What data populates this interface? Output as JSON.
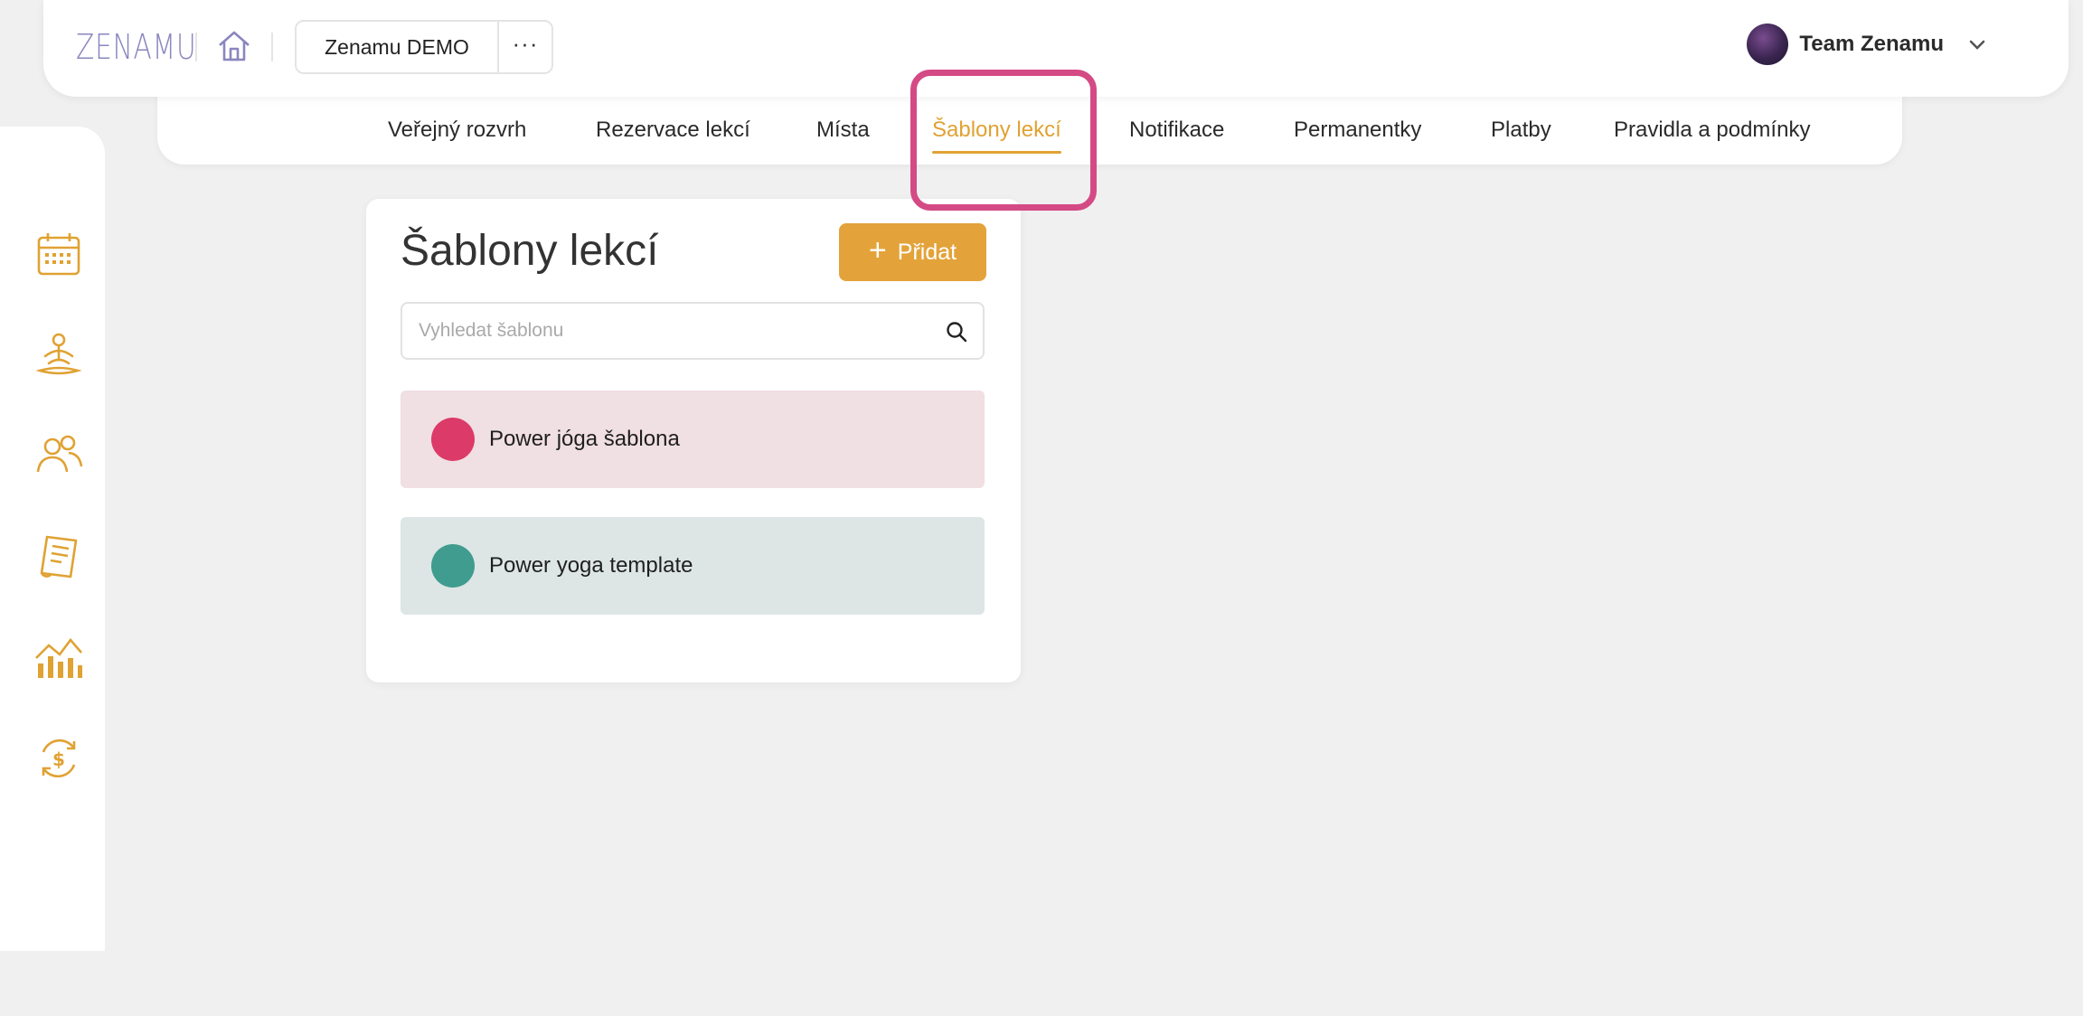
{
  "header": {
    "logo": "ZENAMU",
    "workspace_name": "Zenamu DEMO",
    "more_label": "···",
    "user_name": "Team Zenamu"
  },
  "tabs": [
    {
      "label": "Veřejný rozvrh",
      "active": false
    },
    {
      "label": "Rezervace lekcí",
      "active": false
    },
    {
      "label": "Místa",
      "active": false
    },
    {
      "label": "Šablony lekcí",
      "active": true
    },
    {
      "label": "Notifikace",
      "active": false
    },
    {
      "label": "Permanentky",
      "active": false
    },
    {
      "label": "Platby",
      "active": false
    },
    {
      "label": "Pravidla a podmínky",
      "active": false
    }
  ],
  "sidebar": {
    "items": [
      {
        "icon": "calendar-icon"
      },
      {
        "icon": "yoga-icon"
      },
      {
        "icon": "users-icon"
      },
      {
        "icon": "document-icon"
      },
      {
        "icon": "chart-icon"
      },
      {
        "icon": "payment-icon"
      },
      {
        "icon": "settings-icon",
        "active": true
      }
    ]
  },
  "main": {
    "title": "Šablony lekcí",
    "add_label": "Přidat",
    "search_placeholder": "Vyhledat šablonu",
    "templates": [
      {
        "name": "Power jóga šablona",
        "color": "#dc3a68",
        "bg": "#f0dfe3"
      },
      {
        "name": "Power yoga template",
        "color": "#3f9c8e",
        "bg": "#dde5e5"
      }
    ]
  },
  "colors": {
    "accent": "#e0a233",
    "highlight": "#d44a85",
    "logo": "#8a86bf"
  }
}
